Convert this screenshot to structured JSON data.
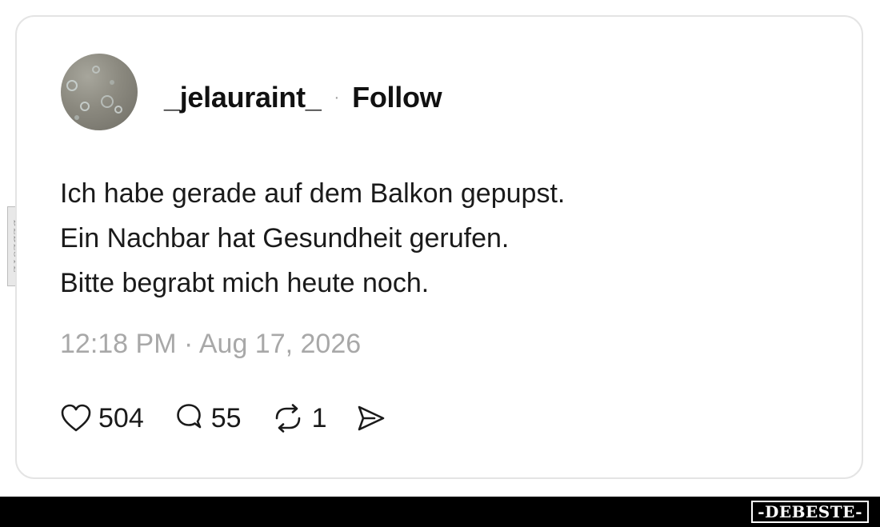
{
  "post": {
    "username": "_jelauraint_",
    "separator": "·",
    "follow_label": "Follow",
    "text_lines": [
      "Ich habe gerade auf dem Balkon gepupst.",
      "Ein Nachbar hat Gesundheit gerufen.",
      "Bitte begrabt mich heute noch."
    ],
    "timestamp": "12:18 PM · Aug 17, 2026"
  },
  "actions": {
    "likes": {
      "icon": "heart-icon",
      "count": "504"
    },
    "replies": {
      "icon": "comment-icon",
      "count": "55"
    },
    "reposts": {
      "icon": "repost-icon",
      "count": "1"
    },
    "share": {
      "icon": "send-icon"
    }
  },
  "watermark": {
    "side_logo": "DEBESTE",
    "footer_logo": "-DEBESTE-"
  },
  "colors": {
    "text": "#1a1a1a",
    "muted": "#a8a8a8",
    "border": "#e4e4e4",
    "footer": "#000000"
  }
}
